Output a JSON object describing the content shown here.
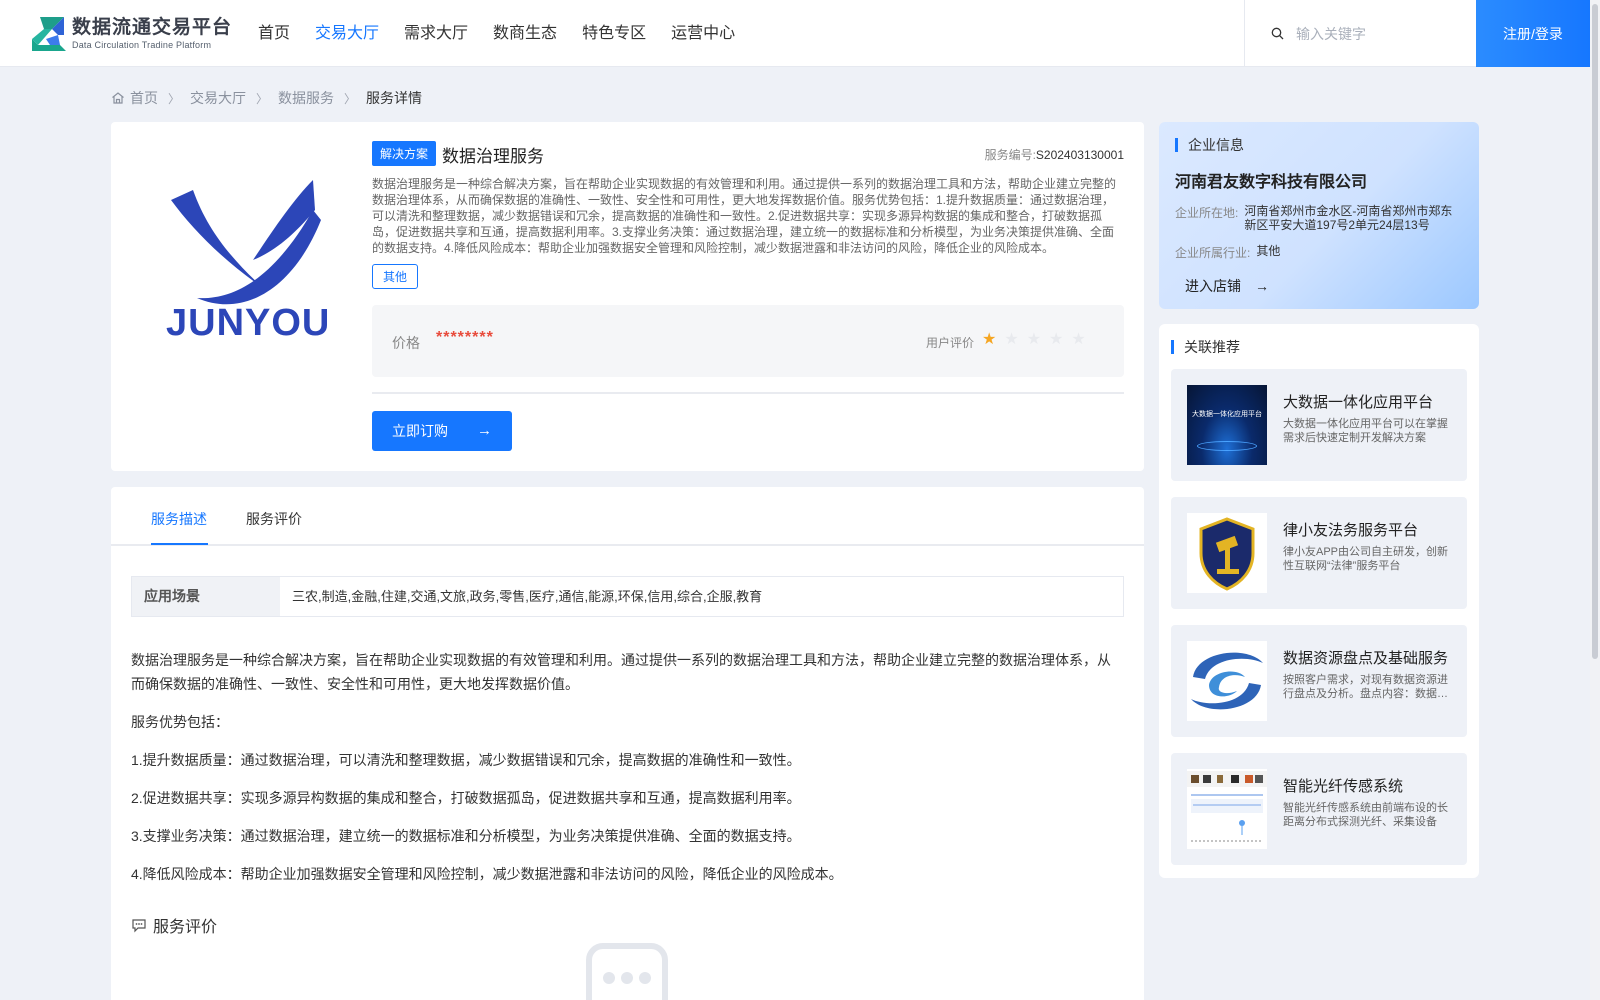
{
  "header": {
    "logo_title": "数据流通交易平台",
    "logo_subtitle": "Data Circulation Tradine Platform",
    "nav": [
      "首页",
      "交易大厅",
      "需求大厅",
      "数商生态",
      "特色专区",
      "运营中心"
    ],
    "active_nav": "交易大厅",
    "search_placeholder": "输入关键字",
    "login_label": "注册/登录",
    "accent_color": "#1677ff"
  },
  "breadcrumb": [
    "首页",
    "交易大厅",
    "数据服务",
    "服务详情"
  ],
  "product": {
    "brand_name": "JUNYOU",
    "solution_tag": "解决方案",
    "title": "数据治理服务",
    "service_no_label": "服务编号:",
    "service_no": "S202403130001",
    "description": "数据治理服务是一种综合解决方案，旨在帮助企业实现数据的有效管理和利用。通过提供一系列的数据治理工具和方法，帮助企业建立完整的数据治理体系，从而确保数据的准确性、一致性、安全性和可用性，更大地发挥数据价值。服务优势包括：1.提升数据质量：通过数据治理，可以清洗和整理数据，减少数据错误和冗余，提高数据的准确性和一致性。2.促进数据共享：实现多源异构数据的集成和整合，打破数据孤岛，促进数据共享和互通，提高数据利用率。3.支撑业务决策：通过数据治理，建立统一的数据标准和分析模型，为业务决策提供准确、全面的数据支持。4.降低风险成本：帮助企业加强数据安全管理和风险控制，减少数据泄露和非法访问的风险，降低企业的风险成本。",
    "category_tag": "其他",
    "price_label": "价格",
    "price_value": "********",
    "rating_label": "用户评价",
    "rating": 1,
    "rating_max": 5,
    "buy_label": "立即订购"
  },
  "company": {
    "section_title": "企业信息",
    "name": "河南君友数字科技有限公司",
    "location_label": "企业所在地:",
    "location": "河南省郑州市金水区-河南省郑州市郑东新区平安大道197号2单元24层13号",
    "industry_label": "企业所属行业:",
    "industry": "其他",
    "enter_store_label": "进入店铺"
  },
  "recommend": {
    "section_title": "关联推荐",
    "items": [
      {
        "title": "大数据一体化应用平台",
        "desc": "大数据一体化应用平台可以在掌握需求后快速定制开发解决方案",
        "thumb_caption": "大数据一体化应用平台",
        "icon": "bigdata-platform-thumb"
      },
      {
        "title": "律小友法务服务平台",
        "desc": "律小友APP由公司自主研发，创新性互联网“法律”服务平台",
        "icon": "law-shield-thumb"
      },
      {
        "title": "数据资源盘点及基础服务",
        "desc": "按照客户需求，对现有数据资源进行盘点及分析。盘点内容：数据资源",
        "icon": "data-swirl-thumb"
      },
      {
        "title": "智能光纤传感系统",
        "desc": "智能光纤传感系统由前端布设的长距离分布式探测光纤、采集设备",
        "icon": "fiber-dashboard-thumb"
      }
    ]
  },
  "detail": {
    "tabs": [
      "服务描述",
      "服务评价"
    ],
    "active_tab": "服务描述",
    "scene_label": "应用场景",
    "scene_value": "三农,制造,金融,住建,交通,文旅,政务,零售,医疗,通信,能源,环保,信用,综合,企服,教育",
    "intro": "数据治理服务是一种综合解决方案，旨在帮助企业实现数据的有效管理和利用。通过提供一系列的数据治理工具和方法，帮助企业建立完整的数据治理体系，从而确保数据的准确性、一致性、安全性和可用性，更大地发挥数据价值。",
    "advantage_head": "服务优势包括：",
    "points": [
      "1.提升数据质量：通过数据治理，可以清洗和整理数据，减少数据错误和冗余，提高数据的准确性和一致性。",
      "2.促进数据共享：实现多源异构数据的集成和整合，打破数据孤岛，促进数据共享和互通，提高数据利用率。",
      "3.支撑业务决策：通过数据治理，建立统一的数据标准和分析模型，为业务决策提供准确、全面的数据支持。",
      "4.降低风险成本：帮助企业加强数据安全管理和风险控制，减少数据泄露和非法访问的风险，降低企业的风险成本。"
    ],
    "review_title": "服务评价"
  }
}
